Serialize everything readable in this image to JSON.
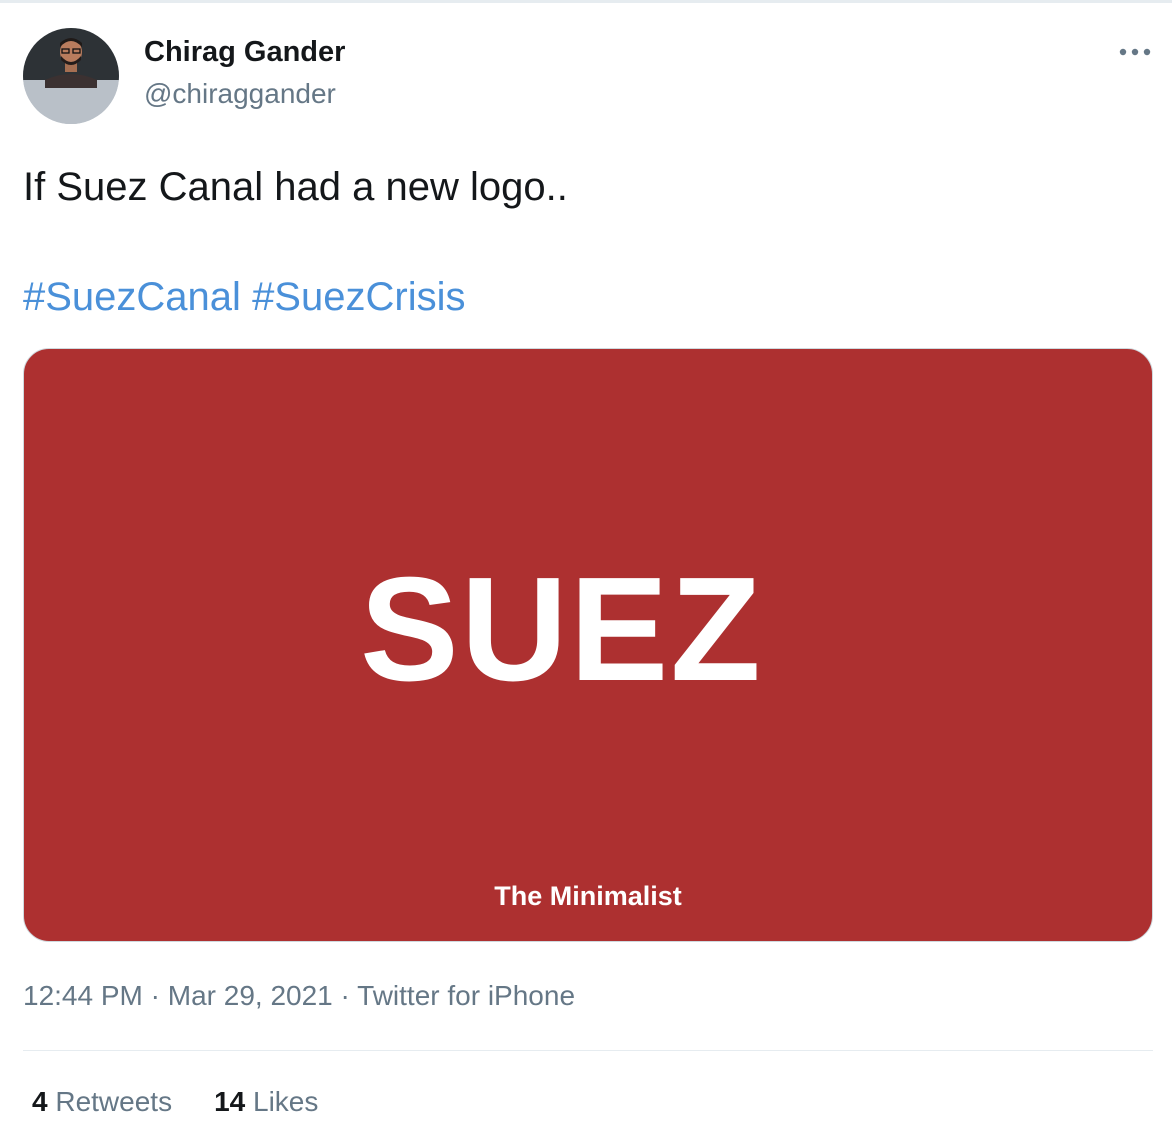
{
  "author": {
    "name": "Chirag Gander",
    "handle": "@chiraggander",
    "avatar_icon": "person-avatar"
  },
  "more_icon": "more-horizontal-icon",
  "tweet": {
    "text": "If Suez Canal had a new logo..",
    "hashtags": [
      "#SuezCanal",
      "#SuezCrisis"
    ]
  },
  "media": {
    "logo_text": "SUEZ",
    "caption": "The Minimalist",
    "background_color": "#ad3030"
  },
  "meta": {
    "time": "12:44 PM",
    "separator": "·",
    "date": "Mar 29, 2021",
    "source": "Twitter for iPhone"
  },
  "stats": {
    "retweets_count": "4",
    "retweets_label": "Retweets",
    "likes_count": "14",
    "likes_label": "Likes"
  },
  "colors": {
    "link": "#4a90d9",
    "muted": "#657786",
    "text": "#14171a"
  }
}
